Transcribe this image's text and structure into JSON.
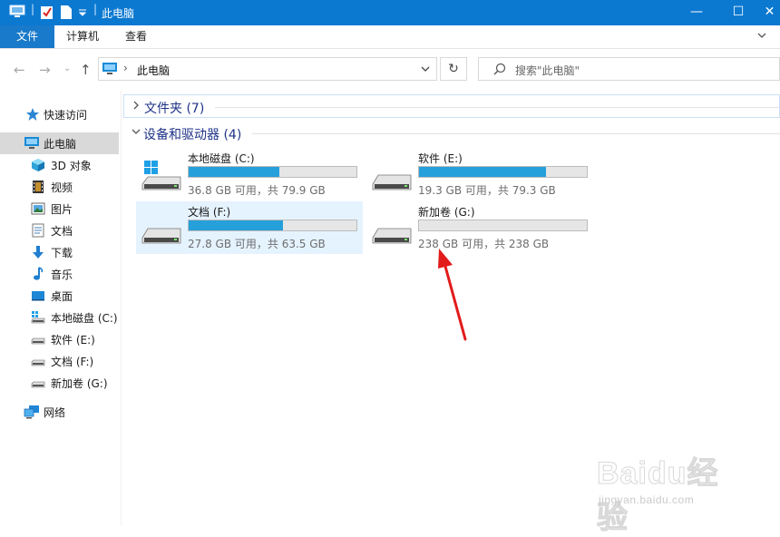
{
  "window": {
    "title": "此电脑",
    "minimize_glyph": "—",
    "maximize_glyph": "☐",
    "close_glyph": "✕"
  },
  "ribbon": {
    "tabs": [
      {
        "label": "文件",
        "active": true
      },
      {
        "label": "计算机",
        "active": false
      },
      {
        "label": "查看",
        "active": false
      }
    ]
  },
  "address": {
    "path": "此电脑",
    "separator": "›",
    "search_placeholder": "搜索\"此电脑\""
  },
  "sidebar": {
    "items": [
      {
        "label": "快速访问",
        "icon": "star-icon"
      },
      {
        "label": "此电脑",
        "icon": "computer-icon",
        "selected": true
      },
      {
        "label": "3D 对象",
        "icon": "cube-icon"
      },
      {
        "label": "视频",
        "icon": "film-icon"
      },
      {
        "label": "图片",
        "icon": "picture-icon"
      },
      {
        "label": "文档",
        "icon": "document-icon"
      },
      {
        "label": "下载",
        "icon": "download-arrow-icon"
      },
      {
        "label": "音乐",
        "icon": "music-note-icon"
      },
      {
        "label": "桌面",
        "icon": "desktop-icon"
      },
      {
        "label": "本地磁盘 (C:)",
        "icon": "system-drive-icon"
      },
      {
        "label": "软件 (E:)",
        "icon": "drive-icon"
      },
      {
        "label": "文档 (F:)",
        "icon": "drive-icon"
      },
      {
        "label": "新加卷 (G:)",
        "icon": "drive-icon"
      },
      {
        "label": "网络",
        "icon": "network-icon"
      }
    ]
  },
  "groups": {
    "folders": {
      "label": "文件夹 (7)",
      "expanded": false
    },
    "devices": {
      "label": "设备和驱动器 (4)",
      "expanded": true
    }
  },
  "drives": [
    {
      "name": "本地磁盘 (C:)",
      "info": "36.8 GB 可用，共 79.9 GB",
      "used_fraction": 0.539,
      "system": true,
      "selected": false
    },
    {
      "name": "软件 (E:)",
      "info": "19.3 GB 可用，共 79.3 GB",
      "used_fraction": 0.757,
      "system": false,
      "selected": false
    },
    {
      "name": "文档 (F:)",
      "info": "27.8 GB 可用，共 63.5 GB",
      "used_fraction": 0.562,
      "system": false,
      "selected": true
    },
    {
      "name": "新加卷 (G:)",
      "info": "238 GB 可用，共 238 GB",
      "used_fraction": 0.0,
      "system": false,
      "selected": false
    }
  ],
  "colors": {
    "titlebar": "#0c79d1",
    "accent": "#1979ca",
    "bar_fill": "#26a0da",
    "arrow": "#e21b1b"
  },
  "watermark": {
    "brand": "Baidu经验",
    "site": "jingyan.baidu.com"
  }
}
